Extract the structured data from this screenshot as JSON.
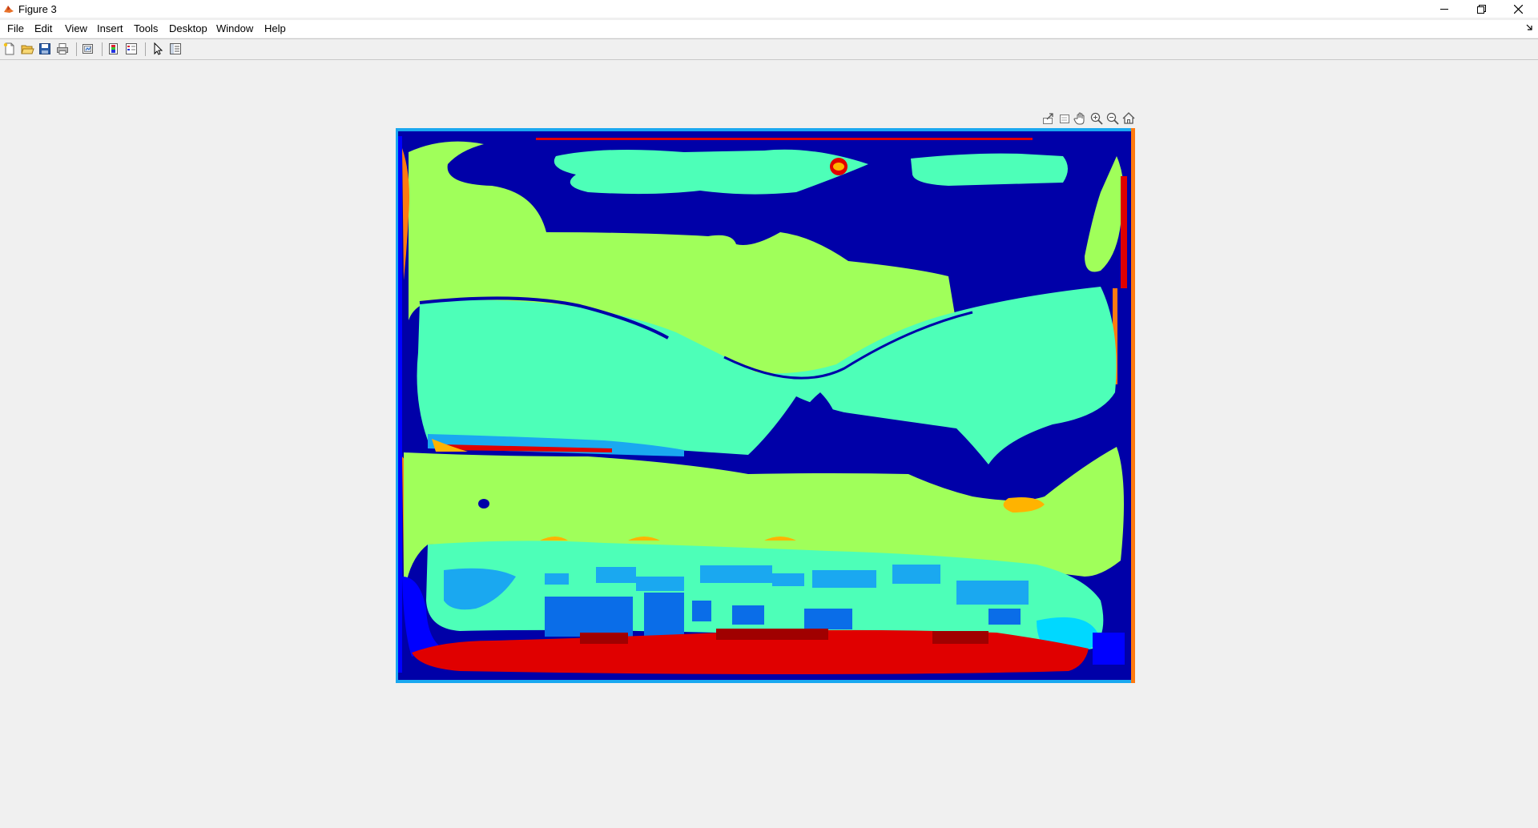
{
  "window": {
    "title": "Figure 3",
    "icon": "matlab-icon",
    "controls": [
      "minimize-icon",
      "restore-icon",
      "close-icon"
    ]
  },
  "menu": {
    "items": [
      "File",
      "Edit",
      "View",
      "Insert",
      "Tools",
      "Desktop",
      "Window",
      "Help"
    ],
    "dock_icon": "dock-arrow-icon"
  },
  "toolbar": {
    "buttons": [
      "new-figure-icon",
      "open-file-icon",
      "save-icon",
      "print-icon",
      "link-plot-icon",
      "insert-colorbar-icon",
      "insert-legend-icon",
      "edit-plot-icon",
      "property-inspector-icon"
    ]
  },
  "axes_toolbar": {
    "buttons": [
      "export-icon",
      "brush-icon",
      "pan-icon",
      "zoom-in-icon",
      "zoom-out-icon",
      "home-icon"
    ]
  },
  "image": {
    "description_colormap": "jet",
    "colors": {
      "dark_blue": "#0000a8",
      "blue": "#0000ff",
      "medium_blue": "#0a6de8",
      "light_blue": "#1aa8f0",
      "cyan": "#00d8ff",
      "mint": "#4dffb8",
      "green": "#a0ff5a",
      "yellow_orange": "#ffb300",
      "orange": "#ff7a10",
      "red": "#e00000",
      "dark_red": "#a00000"
    }
  }
}
